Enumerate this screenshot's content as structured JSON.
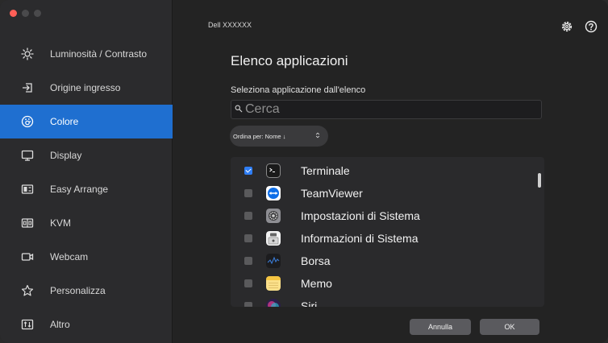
{
  "window": {
    "title": "Dell XXXXXX"
  },
  "sidebar": {
    "items": [
      {
        "label": "Luminosità / Contrasto",
        "icon": "brightness-icon",
        "active": false
      },
      {
        "label": "Origine ingresso",
        "icon": "input-source-icon",
        "active": false
      },
      {
        "label": "Colore",
        "icon": "color-icon",
        "active": true
      },
      {
        "label": "Display",
        "icon": "display-icon",
        "active": false
      },
      {
        "label": "Easy Arrange",
        "icon": "easy-arrange-icon",
        "active": false
      },
      {
        "label": "KVM",
        "icon": "kvm-icon",
        "active": false
      },
      {
        "label": "Webcam",
        "icon": "webcam-icon",
        "active": false
      },
      {
        "label": "Personalizza",
        "icon": "star-icon",
        "active": false
      },
      {
        "label": "Altro",
        "icon": "other-icon",
        "active": false
      }
    ]
  },
  "main": {
    "title": "Elenco applicazioni",
    "subtitle": "Seleziona applicazione dall'elenco",
    "search": {
      "placeholder": "Cerca",
      "value": ""
    },
    "sort": {
      "label": "Ordina per: Nome ↓",
      "chevron": "⌃⌄"
    },
    "apps": [
      {
        "name": "Terminale",
        "checked": true,
        "icon": "terminal-icon"
      },
      {
        "name": "TeamViewer",
        "checked": false,
        "icon": "teamviewer-icon"
      },
      {
        "name": "Impostazioni di Sistema",
        "checked": false,
        "icon": "system-settings-icon"
      },
      {
        "name": "Informazioni di Sistema",
        "checked": false,
        "icon": "system-information-icon"
      },
      {
        "name": "Borsa",
        "checked": false,
        "icon": "stocks-icon"
      },
      {
        "name": "Memo",
        "checked": false,
        "icon": "notes-icon"
      },
      {
        "name": "Siri",
        "checked": false,
        "icon": "siri-icon"
      }
    ],
    "buttons": {
      "cancel": "Annulla",
      "ok": "OK"
    }
  },
  "colors": {
    "accent": "#1f6fd0",
    "checkbox_on": "#2f7ef5"
  }
}
